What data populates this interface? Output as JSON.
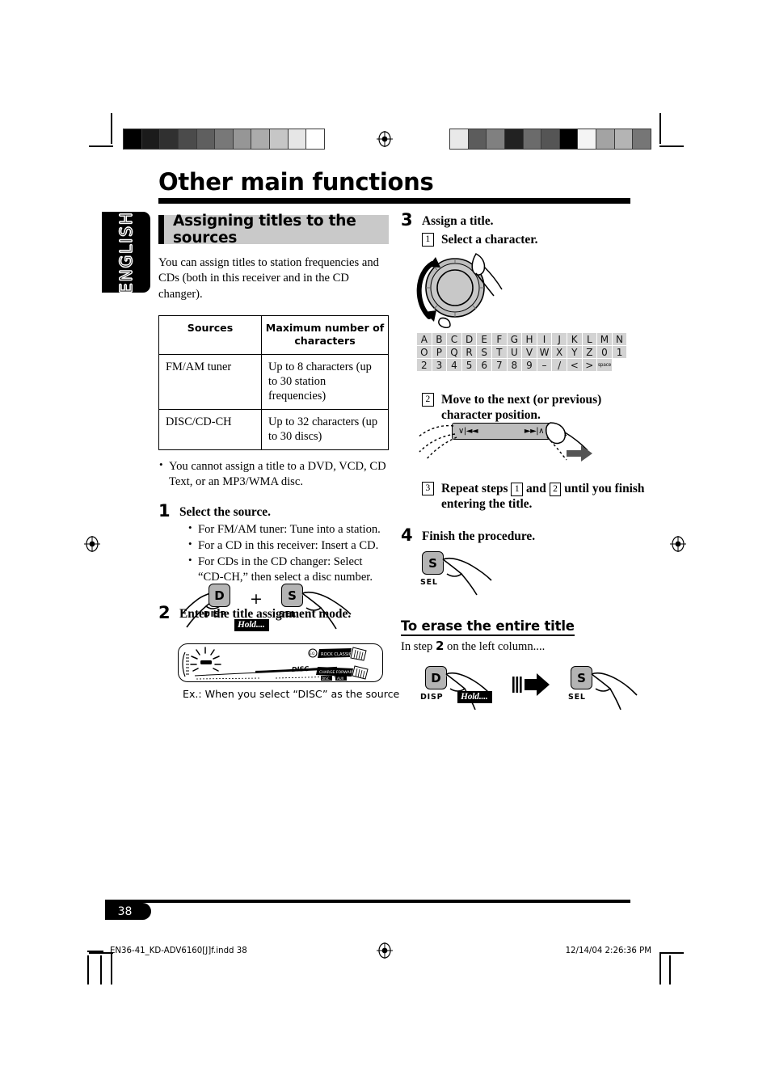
{
  "page": {
    "title": "Other main functions",
    "language_tab": "ENGLISH",
    "number": "38"
  },
  "footer": {
    "file": "EN36-41_KD-ADV6160[J]f.indd   38",
    "timestamp": "12/14/04   2:26:36 PM"
  },
  "left_column": {
    "section_heading": "Assigning titles to the sources",
    "intro": "You can assign titles to station frequencies and CDs (both in this receiver and in the CD changer).",
    "table": {
      "headers": [
        "Sources",
        "Maximum number of characters"
      ],
      "rows": [
        [
          "FM/AM tuner",
          "Up to 8 characters (up to 30 station frequencies)"
        ],
        [
          "DISC/CD-CH",
          "Up to 32 characters (up to 30 discs)"
        ]
      ]
    },
    "note_bullets": [
      "You cannot assign a title to a DVD, VCD, CD Text, or an MP3/WMA disc."
    ],
    "step1": {
      "number": "1",
      "heading": "Select the source.",
      "bullets": [
        "For FM/AM tuner: Tune into a station.",
        "For a CD in this receiver: Insert a CD.",
        "For CDs in the CD changer: Select “CD-CH,” then select a disc number."
      ]
    },
    "step2": {
      "number": "2",
      "heading": "Enter the title assignment mode.",
      "keys": {
        "disp_glyph": "D",
        "disp_label": "DISP",
        "plus": "+",
        "sel_glyph": "S",
        "sel_label": "SEL",
        "hold_badge": "Hold...."
      },
      "display_text": "DISC",
      "display_caption": "Ex.: When you select “DISC” as the source"
    }
  },
  "right_column": {
    "step3": {
      "number": "3",
      "heading": "Assign a title.",
      "sub1": {
        "num": "1",
        "text": "Select a character."
      },
      "sub2": {
        "num": "2",
        "text": "Move to the next (or previous) character position."
      },
      "sub3_parts": {
        "before": "Repeat steps ",
        "ref1": "1",
        "middle": " and ",
        "ref2": "2",
        "after": " until you finish entering the title.",
        "num": "3"
      },
      "char_grid": [
        [
          "A",
          "B",
          "C",
          "D",
          "E",
          "F",
          "G",
          "H",
          "I",
          "J",
          "K",
          "L",
          "M",
          "N"
        ],
        [
          "O",
          "P",
          "Q",
          "R",
          "S",
          "T",
          "U",
          "V",
          "W",
          "X",
          "Y",
          "Z",
          "0",
          "1"
        ],
        [
          "2",
          "3",
          "4",
          "5",
          "6",
          "7",
          "8",
          "9",
          "–",
          "/",
          "<",
          ">",
          "space",
          ""
        ]
      ],
      "rocker": {
        "left": "∨|◄◄",
        "right": "►►|∧"
      }
    },
    "step4": {
      "number": "4",
      "heading": "Finish the procedure.",
      "key_glyph": "S",
      "key_label": "SEL"
    },
    "erase_section": {
      "heading": "To erase the entire title",
      "text_before": "In step ",
      "text_number": "2",
      "text_after": " on the left column....",
      "key1_glyph": "D",
      "key1_label": "DISP",
      "hold_badge": "Hold....",
      "key2_glyph": "S",
      "key2_label": "SEL"
    }
  },
  "calibration": {
    "left_strip": [
      "#000000",
      "#1b1b1b",
      "#303030",
      "#4b4b4b",
      "#5f5f5f",
      "#787878",
      "#969696",
      "#ababab",
      "#c6c6c6",
      "#e6e6e6",
      "#ffffff"
    ],
    "right_strip": [
      "#e9e9e9",
      "#5c5c5c",
      "#808080",
      "#222222",
      "#6b6b6b",
      "#555555",
      "#000000",
      "#f4f4f4",
      "#a3a3a3",
      "#b4b4b4",
      "#767676"
    ]
  }
}
